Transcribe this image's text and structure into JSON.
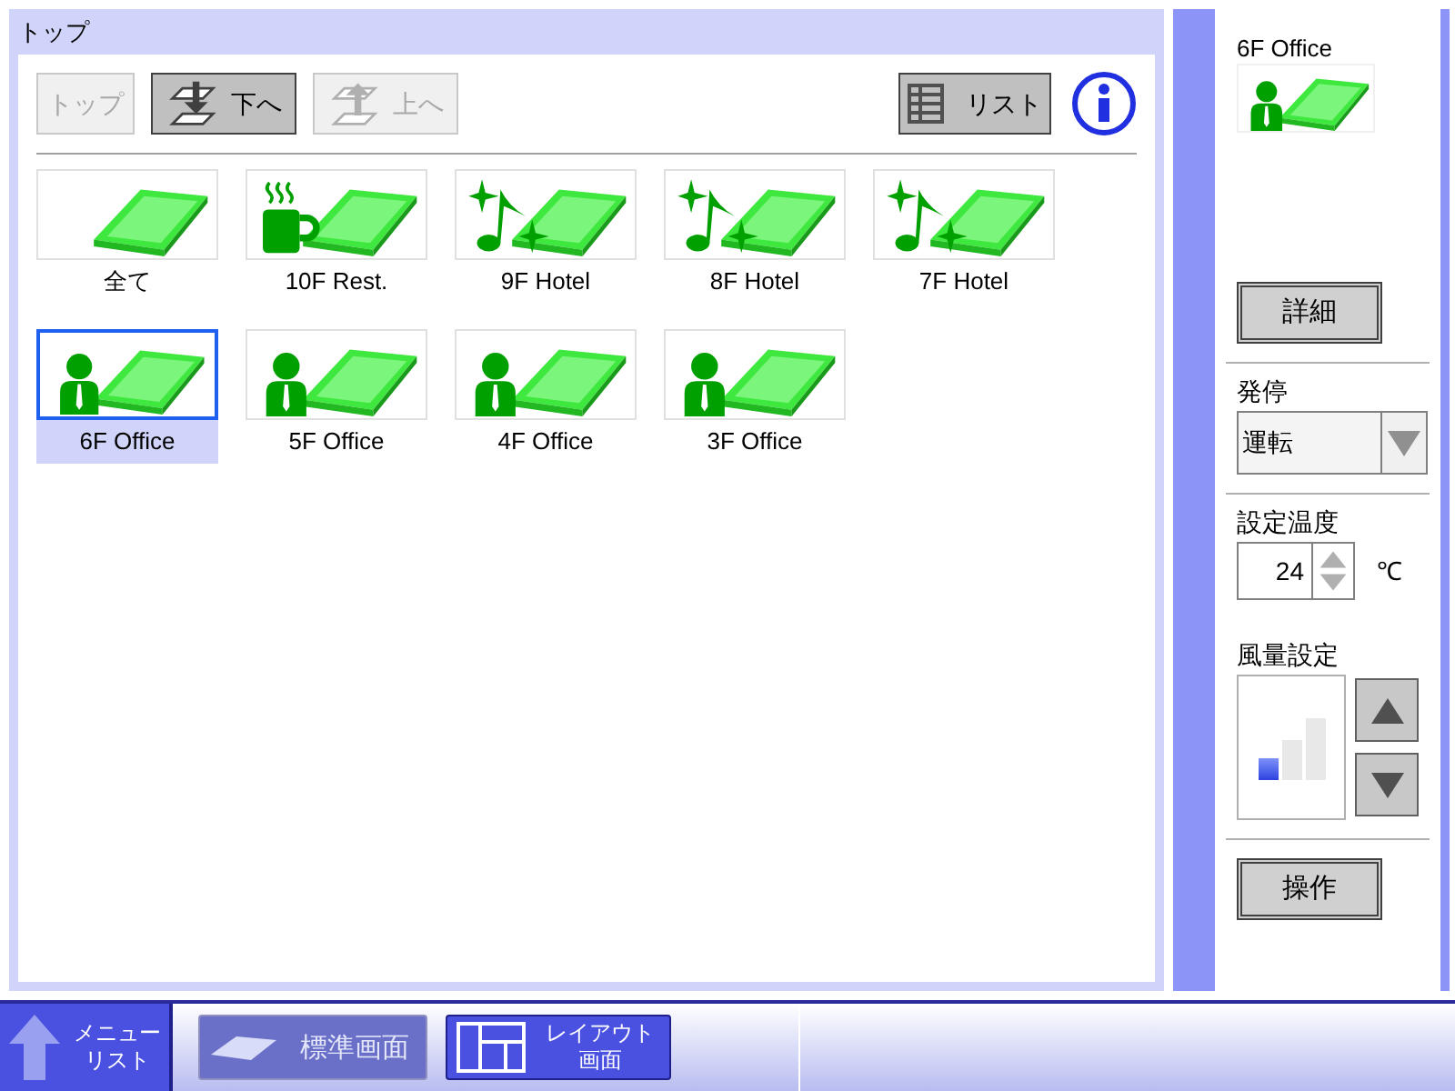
{
  "panel": {
    "title": "トップ"
  },
  "toolbar": [
    {
      "kind": "plain",
      "label": "トップ",
      "disabled": true
    },
    {
      "kind": "down",
      "label": "下へ",
      "disabled": false
    },
    {
      "kind": "up",
      "label": "上へ",
      "disabled": true
    }
  ],
  "list_button": {
    "label": "リスト"
  },
  "floors": [
    {
      "kind": "all",
      "label": "全て",
      "selected": false
    },
    {
      "kind": "restaurant",
      "label": "10F Rest.",
      "selected": false
    },
    {
      "kind": "hotel",
      "label": "9F Hotel",
      "selected": false
    },
    {
      "kind": "hotel",
      "label": "8F Hotel",
      "selected": false
    },
    {
      "kind": "hotel",
      "label": "7F Hotel",
      "selected": false
    },
    {
      "kind": "office",
      "label": "6F Office",
      "selected": true
    },
    {
      "kind": "office",
      "label": "5F Office",
      "selected": false
    },
    {
      "kind": "office",
      "label": "4F Office",
      "selected": false
    },
    {
      "kind": "office",
      "label": "3F Office",
      "selected": false
    }
  ],
  "detail": {
    "title": "6F Office",
    "kind": "office",
    "details_button": "詳細",
    "run": {
      "label": "発停",
      "value": "運転"
    },
    "temperature": {
      "label": "設定温度",
      "value": "24",
      "unit": "℃"
    },
    "fan": {
      "label": "風量設定",
      "level": 0.33
    },
    "operate_button": "操作"
  },
  "taskbar": [
    {
      "kind": "menu",
      "lines": [
        "メニュー",
        "リスト"
      ],
      "disabled": false
    },
    {
      "kind": "standard",
      "lines": [
        "標準画面"
      ],
      "disabled": true
    },
    {
      "kind": "layout",
      "lines": [
        "レイアウト",
        "画面"
      ],
      "disabled": false
    }
  ]
}
